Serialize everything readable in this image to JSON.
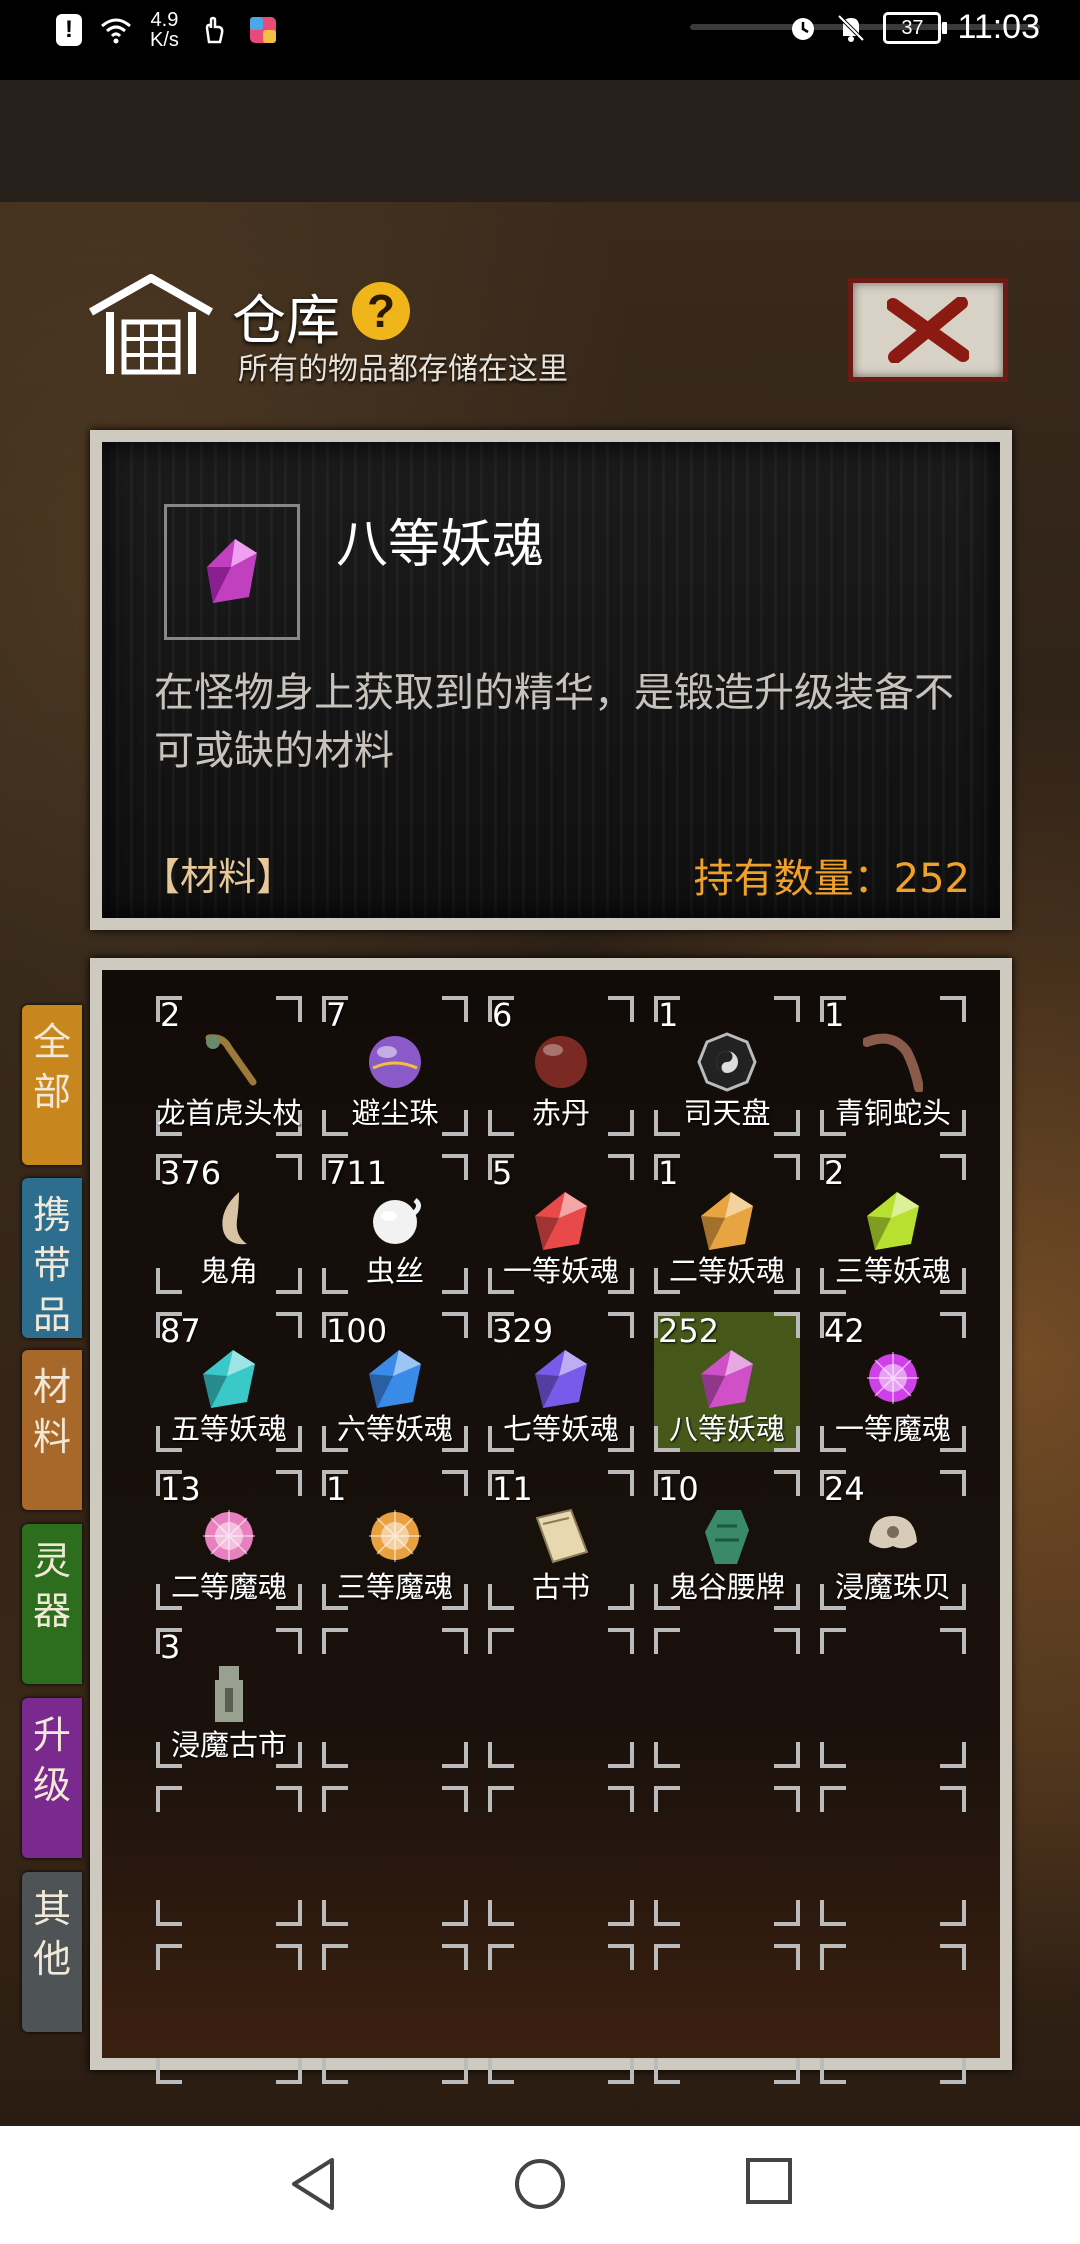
{
  "status_bar": {
    "speed": [
      "4.9",
      "K/s"
    ],
    "battery": "37",
    "time": "11:03"
  },
  "header": {
    "title": "仓库",
    "help_symbol": "?",
    "subtitle": "所有的物品都存储在这里"
  },
  "detail": {
    "name": "八等妖魂",
    "description": "在怪物身上获取到的精华，是锻造升级装备不可或缺的材料",
    "category": "【材料】",
    "count_label": "持有数量：",
    "count_value": "252"
  },
  "tabs": [
    {
      "label": "全部",
      "color": "#c8861e"
    },
    {
      "label": "携带品",
      "color": "#2d6e8e"
    },
    {
      "label": "材料",
      "color": "#a8682a"
    },
    {
      "label": "灵器",
      "color": "#2c6e1e"
    },
    {
      "label": "升级",
      "color": "#7a2a8e"
    },
    {
      "label": "其他",
      "color": "#4e5456"
    }
  ],
  "items": [
    {
      "qty": "2",
      "name": "龙首虎头杖",
      "icon": "staff-icon",
      "color": "#9c7a3a"
    },
    {
      "qty": "7",
      "name": "避尘珠",
      "icon": "orb-icon",
      "color": "#8a5ac8"
    },
    {
      "qty": "6",
      "name": "赤丹",
      "icon": "pill-icon",
      "color": "#7a2a22"
    },
    {
      "qty": "1",
      "name": "司天盘",
      "icon": "bagua-icon",
      "color": "#bbbbbb"
    },
    {
      "qty": "1",
      "name": "青铜蛇头",
      "icon": "snake-icon",
      "color": "#8a5a4a"
    },
    {
      "qty": "376",
      "name": "鬼角",
      "icon": "horn-icon",
      "color": "#d8c4a2"
    },
    {
      "qty": "711",
      "name": "虫丝",
      "icon": "silk-icon",
      "color": "#f2f2f2"
    },
    {
      "qty": "5",
      "name": "一等妖魂",
      "icon": "crystal-icon",
      "color": "#e84a4a"
    },
    {
      "qty": "1",
      "name": "二等妖魂",
      "icon": "crystal-icon",
      "color": "#e8a440"
    },
    {
      "qty": "2",
      "name": "三等妖魂",
      "icon": "crystal-icon",
      "color": "#b8e030"
    },
    {
      "qty": "87",
      "name": "五等妖魂",
      "icon": "crystal-icon",
      "color": "#3ac8c8"
    },
    {
      "qty": "100",
      "name": "六等妖魂",
      "icon": "crystal-icon",
      "color": "#3a8ae8"
    },
    {
      "qty": "329",
      "name": "七等妖魂",
      "icon": "crystal-icon",
      "color": "#7a5ae8"
    },
    {
      "qty": "252",
      "name": "八等妖魂",
      "icon": "crystal-icon",
      "color": "#d050c8",
      "selected": true
    },
    {
      "qty": "42",
      "name": "一等魔魂",
      "icon": "spark-orb-icon",
      "color": "#d040e8"
    },
    {
      "qty": "13",
      "name": "二等魔魂",
      "icon": "spark-orb-icon",
      "color": "#e880c0"
    },
    {
      "qty": "1",
      "name": "三等魔魂",
      "icon": "spark-orb-icon",
      "color": "#e8a040"
    },
    {
      "qty": "11",
      "name": "古书",
      "icon": "book-icon",
      "color": "#e8d8b0"
    },
    {
      "qty": "10",
      "name": "鬼谷腰牌",
      "icon": "jade-token-icon",
      "color": "#3a8a6a"
    },
    {
      "qty": "24",
      "name": "浸魔珠贝",
      "icon": "shell-icon",
      "color": "#d8ccb8"
    },
    {
      "qty": "3",
      "name": "浸魔古市",
      "icon": "coin-icon",
      "color": "#9aa090"
    }
  ]
}
